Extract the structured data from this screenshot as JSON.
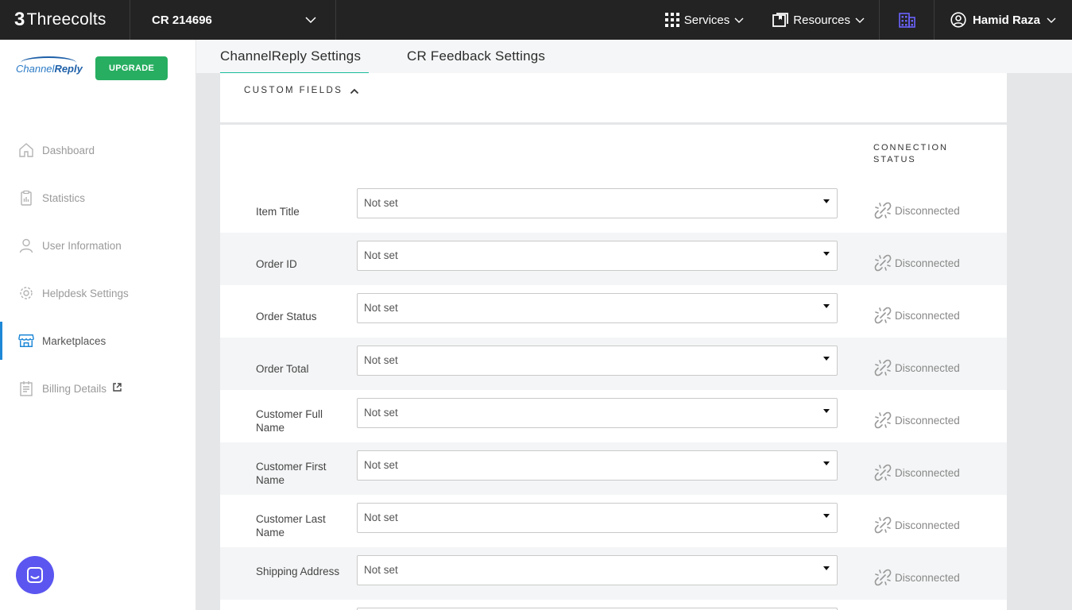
{
  "topbar": {
    "brand": "Threecolts",
    "brand_mark": "3",
    "account": "CR 214696",
    "services_label": "Services",
    "resources_label": "Resources",
    "user_name": "Hamid Raza"
  },
  "sidebar": {
    "logo_text_1": "Channel",
    "logo_text_2": "Reply",
    "upgrade_label": "UPGRADE",
    "items": [
      {
        "label": "Dashboard",
        "icon": "home-icon"
      },
      {
        "label": "Statistics",
        "icon": "clipboard-chart-icon"
      },
      {
        "label": "User Information",
        "icon": "user-icon"
      },
      {
        "label": "Helpdesk Settings",
        "icon": "gear-icon"
      },
      {
        "label": "Marketplaces",
        "icon": "store-icon",
        "active": true
      },
      {
        "label": "Billing Details",
        "icon": "invoice-icon",
        "external": true
      }
    ]
  },
  "tabs": [
    "ChannelReply Settings",
    "CR Feedback Settings"
  ],
  "section": {
    "title": "CUSTOM FIELDS",
    "column_header_1": "CONNECTION",
    "column_header_2": "STATUS"
  },
  "fields": [
    {
      "label": "Item Title",
      "value": "Not set",
      "status": "Disconnected"
    },
    {
      "label": "Order ID",
      "value": "Not set",
      "status": "Disconnected"
    },
    {
      "label": "Order Status",
      "value": "Not set",
      "status": "Disconnected"
    },
    {
      "label": "Order Total",
      "value": "Not set",
      "status": "Disconnected"
    },
    {
      "label": "Customer Full Name",
      "value": "Not set",
      "status": "Disconnected"
    },
    {
      "label": "Customer First Name",
      "value": "Not set",
      "status": "Disconnected"
    },
    {
      "label": "Customer Last Name",
      "value": "Not set",
      "status": "Disconnected"
    },
    {
      "label": "Shipping Address",
      "value": "Not set",
      "status": "Disconnected"
    }
  ],
  "colors": {
    "topbar": "#232323",
    "upgrade": "#27ae60",
    "tab_underline": "#1abc9c",
    "active_indicator": "#1e88d7",
    "chat_bubble": "#5b56f0"
  }
}
